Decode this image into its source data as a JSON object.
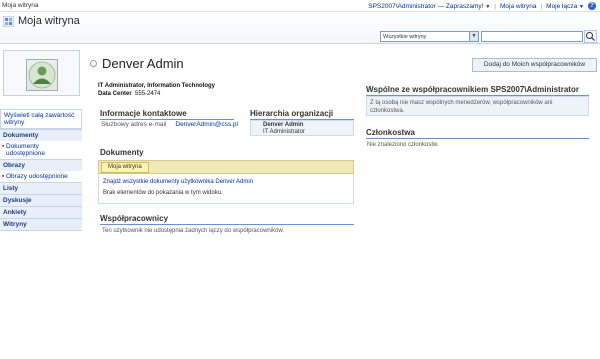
{
  "topbar": {
    "site_link": "Moja witryna",
    "user_menu": "SPS2007\\Administrator — Zapraszamy!",
    "my_site": "Moja witryna",
    "my_links": "Moje łącza"
  },
  "header": {
    "title": "Moja witryna",
    "scope_value": "Wszystkie witryny",
    "search_placeholder": ""
  },
  "leftnav": {
    "view_all": "Wyświetl całą zawartość witryny",
    "sections": [
      {
        "label": "Dokumenty",
        "items": [
          "Dokumenty udostępnione"
        ]
      },
      {
        "label": "Obrazy",
        "items": [
          "Obrazy udostępnione"
        ]
      },
      {
        "label": "Listy",
        "items": []
      },
      {
        "label": "Dyskusje",
        "items": []
      },
      {
        "label": "Ankiety",
        "items": []
      },
      {
        "label": "Witryny",
        "items": []
      }
    ]
  },
  "profile": {
    "name": "Denver Admin",
    "add_colleague": "Dodaj do Moich współpracowników",
    "title_line": "IT Administrator, Information Technology",
    "data_center_label": "Data Center",
    "data_center_value": "555-2474"
  },
  "contact": {
    "heading": "Informacje kontaktowe",
    "email_label": "Służbowy adres e-mail",
    "email_value": "DenverAdmin@css.pl"
  },
  "org": {
    "heading": "Hierarchia organizacji",
    "person_name": "Denver Admin",
    "person_title": "IT Administrator"
  },
  "documents": {
    "heading": "Dokumenty",
    "tab": "Moja witryna",
    "find_link": "Znajdź wszystkie dokumenty użytkownika Denver Admin",
    "empty": "Brak elementów do pokazania w tym widoku."
  },
  "colleagues": {
    "heading": "Współpracownicy",
    "text": "Ten użytkownik nie udostępnia żadnych łączy do współpracowników."
  },
  "shared": {
    "heading": "Wspólne ze współpracownikiem SPS2007\\Administrator",
    "text": "Z tą osobą nie masz wspólnych menedżerów, współpracowników ani członkostwa."
  },
  "membership": {
    "heading": "Członkostwa",
    "text": "Nie znaleziono członkostw."
  }
}
